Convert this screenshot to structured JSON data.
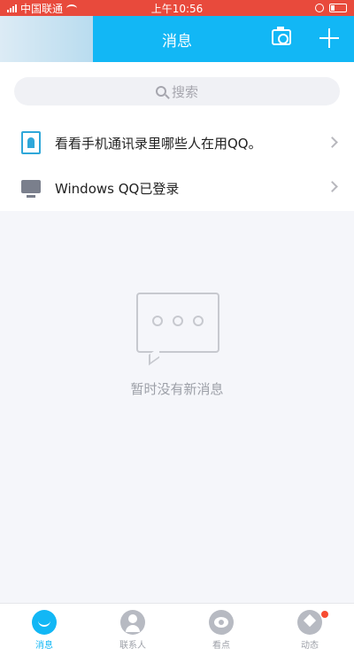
{
  "status_bar": {
    "carrier": "中国联通",
    "time": "上午10:56"
  },
  "header": {
    "title": "消息"
  },
  "search": {
    "placeholder": "搜索"
  },
  "list": [
    {
      "label": "看看手机通讯录里哪些人在用QQ。",
      "icon": "contacts-icon"
    },
    {
      "label": "Windows QQ已登录",
      "icon": "monitor-icon"
    }
  ],
  "empty_state": {
    "text": "暂时没有新消息"
  },
  "tabs": [
    {
      "label": "消息",
      "active": true
    },
    {
      "label": "联系人",
      "active": false
    },
    {
      "label": "看点",
      "active": false
    },
    {
      "label": "动态",
      "active": false
    }
  ],
  "colors": {
    "accent": "#12b7f5",
    "status_bar": "#e84a3c",
    "background": "#f5f6fa"
  }
}
